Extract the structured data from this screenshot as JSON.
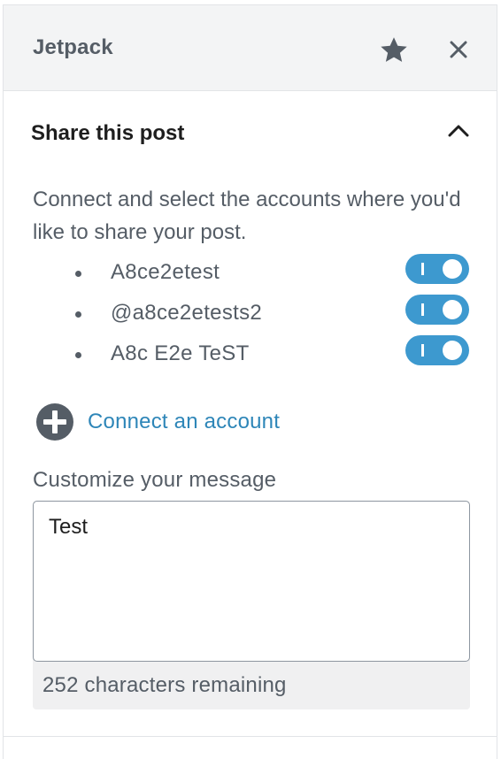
{
  "panel": {
    "title": "Jetpack",
    "star_icon": "star-icon",
    "close_icon": "close-icon"
  },
  "share": {
    "title": "Share this post",
    "expanded": true,
    "intro": "Connect and select the accounts where you'd like to share your post.",
    "accounts": [
      {
        "name": "A8ce2etest",
        "enabled": true
      },
      {
        "name": "@a8ce2etests2",
        "enabled": true
      },
      {
        "name": "A8c E2e TeST",
        "enabled": true
      }
    ],
    "connect_label": "Connect an account",
    "message_label": "Customize your message",
    "message_value": "Test",
    "remaining_text": "252 characters remaining"
  },
  "colors": {
    "accent": "#3d99cf",
    "link": "#2e86b8",
    "muted_text": "#555d66",
    "header_bg": "#f3f4f5"
  }
}
